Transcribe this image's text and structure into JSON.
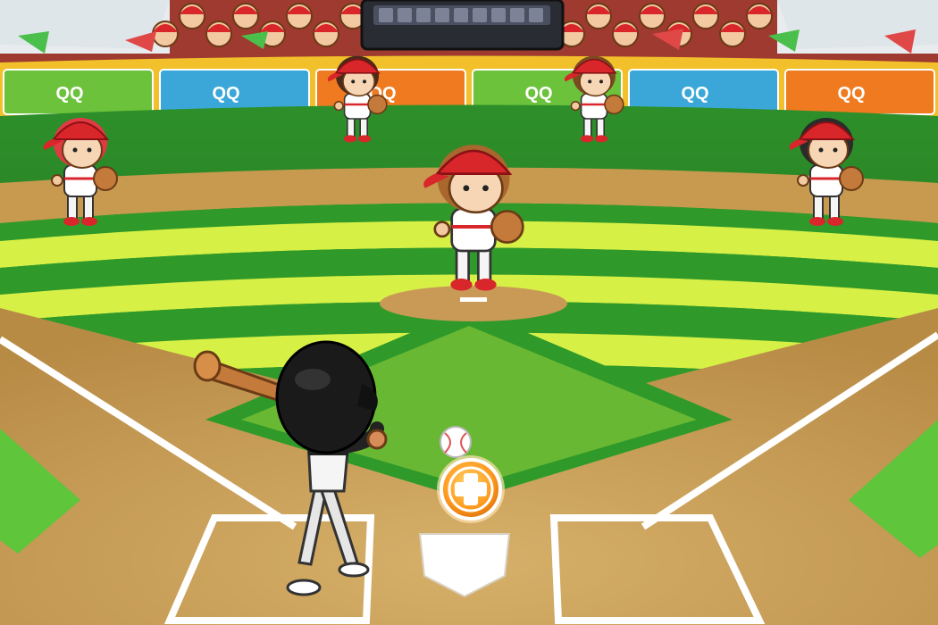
{
  "scene": {
    "title": "Baseball batting scene",
    "colors": {
      "grass_light": "#d6f046",
      "grass_dark": "#2f9a2a",
      "dirt": "#c9a25a",
      "dirt_dark": "#b58843",
      "cap_red": "#d8262b",
      "wall_blue": "#3aa7d8",
      "wall_orange": "#f07a1f",
      "wall_green": "#6cc23a",
      "crowd_bg": "#c8473a",
      "scoreboard": "#2a2c33",
      "accent_orange": "#ff9a1e"
    }
  },
  "ad_boards": [
    {
      "logo": "QQ",
      "color": "#6cc23a"
    },
    {
      "logo": "QQ",
      "color": "#3aa7d8"
    },
    {
      "logo": "QQ",
      "color": "#f07a1f"
    },
    {
      "logo": "QQ",
      "color": "#6cc23a"
    },
    {
      "logo": "QQ",
      "color": "#3aa7d8"
    },
    {
      "logo": "QQ",
      "color": "#f07a1f"
    }
  ],
  "fielders": [
    {
      "role": "left-fielder",
      "hair": "#e23a44"
    },
    {
      "role": "center-left-fielder",
      "hair": "#4b2a1a"
    },
    {
      "role": "center-right-fielder",
      "hair": "#7a4a20"
    },
    {
      "role": "right-fielder",
      "hair": "#2b2b2b"
    },
    {
      "role": "pitcher",
      "hair": "#a9672e"
    }
  ],
  "hud": {
    "bonus_icon": "plus-coin-icon"
  }
}
